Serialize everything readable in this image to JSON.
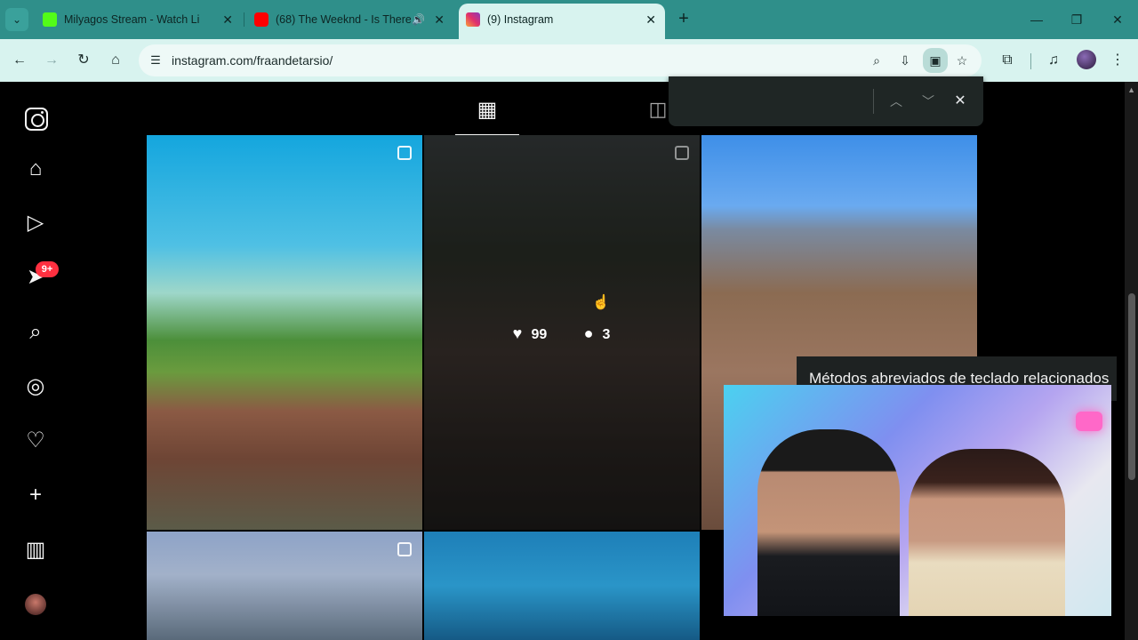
{
  "browser": {
    "tabs": [
      {
        "title": "Milyagos Stream - Watch Live o",
        "favicon_color": "#53fc18",
        "active": false,
        "audio": false
      },
      {
        "title": "(68) The Weeknd - Is There",
        "favicon_color": "#ff0000",
        "active": false,
        "audio": true
      },
      {
        "title": "(9) Instagram",
        "favicon_color": "#e1306c",
        "active": true,
        "audio": false
      }
    ],
    "url": "instagram.com/fraandetarsio/",
    "icons": {
      "tab_list": "chevron-down-icon",
      "new_tab": "plus-icon",
      "back": "arrow-left-icon",
      "forward": "arrow-right-icon",
      "reload": "reload-icon",
      "home": "home-icon",
      "site_info": "tune-icon",
      "zoom": "zoom-icon",
      "install": "install-app-icon",
      "reader": "reader-mode-icon",
      "bookmark": "star-icon",
      "extensions": "puzzle-icon",
      "media": "media-control-icon",
      "menu": "kebab-menu-icon"
    }
  },
  "findbar": {
    "query": ""
  },
  "sidebar": {
    "notifications_badge": "9+"
  },
  "grid": {
    "hovered_post": {
      "likes": "99",
      "comments": "3"
    }
  },
  "tooltip": {
    "text": "Métodos abreviados de teclado relacionados"
  },
  "colors": {
    "accent": "#2f8f8a",
    "badge": "#ff3040",
    "background": "#000000"
  }
}
